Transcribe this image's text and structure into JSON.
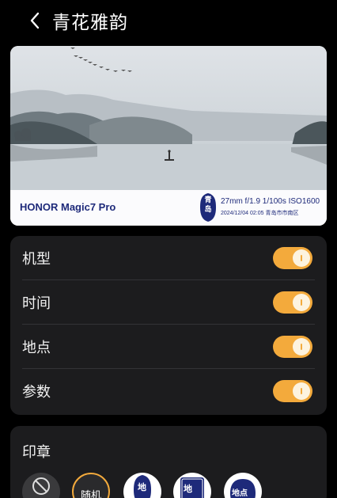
{
  "header": {
    "title": "青花雅韵"
  },
  "preview": {
    "brand": "HONOR Magic7 Pro",
    "seal_text": "青岛",
    "params": "27mm  f/1.9  1/100s  ISO1600",
    "datetime_location": "2024/12/04 02:05  青岛市市南区"
  },
  "toggles": [
    {
      "label": "机型",
      "on": true
    },
    {
      "label": "时间",
      "on": true
    },
    {
      "label": "地点",
      "on": true
    },
    {
      "label": "参数",
      "on": true
    }
  ],
  "seal": {
    "title": "印章",
    "random_label": "随机",
    "options": [
      {
        "glyph": "地"
      },
      {
        "glyph": "地"
      },
      {
        "glyph": "地点"
      }
    ]
  },
  "colors": {
    "accent": "#f3aa3c",
    "card_bg": "#1c1c1e",
    "brand_blue": "#1e2a7a"
  }
}
